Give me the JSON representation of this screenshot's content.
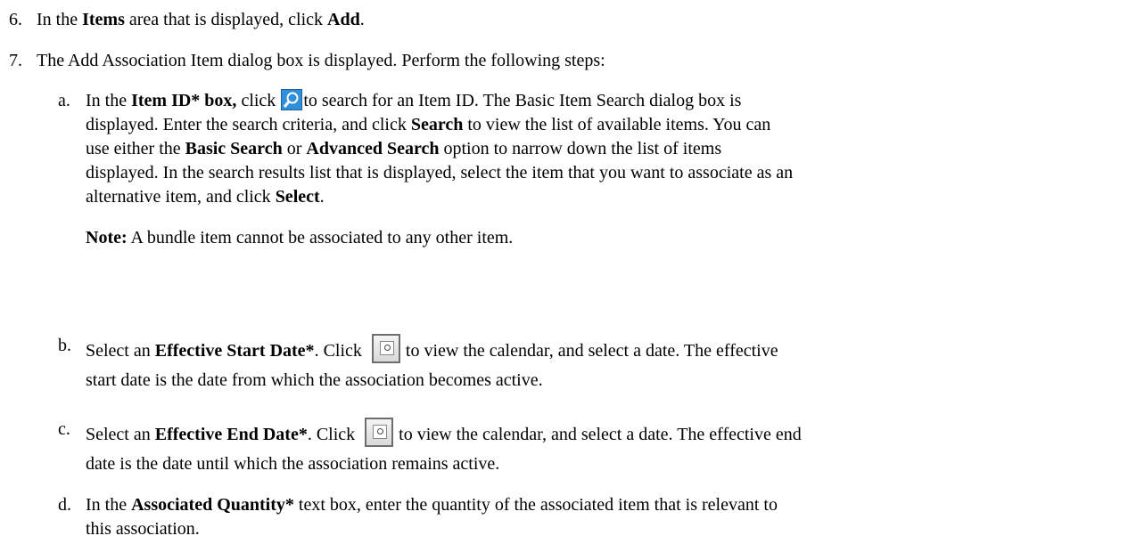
{
  "step6": {
    "num": "6.",
    "t1": "In the ",
    "b1": "Items",
    "t2": " area that is displayed, click ",
    "b2": "Add",
    "t3": "."
  },
  "step7": {
    "num": "7.",
    "text": "The Add Association Item dialog box is displayed. Perform the following steps:"
  },
  "sub_a": {
    "letter": "a.",
    "t1": "In the ",
    "b1": "Item ID* box,",
    "t2": " click ",
    "t3": "to search for an Item ID. The Basic Item Search dialog box is",
    "line2_t1": "displayed. Enter the search criteria, and click ",
    "line2_b1": "Search",
    "line2_t2": " to view the list of available items. You can",
    "line3_t1": "use either the ",
    "line3_b1": "Basic Search",
    "line3_t2": " or ",
    "line3_b2": "Advanced Search",
    "line3_t3": " option to narrow down the list of items",
    "line4": "displayed. In the search results list that is displayed, select the item that you want to associate as an",
    "line5_t1": "alternative item, and click ",
    "line5_b1": "Select",
    "line5_t2": ".",
    "note_b": "Note:",
    "note_t": " A bundle item cannot be associated to any other item."
  },
  "sub_b": {
    "letter": "b.",
    "t1": "Select an ",
    "b1": "Effective Start Date*",
    "t2": ". Click ",
    "t3": "to view the calendar, and select a date. The effective",
    "line2": "start date is the date from which the association becomes active."
  },
  "sub_c": {
    "letter": "c.",
    "t1": "Select an ",
    "b1": "Effective End Date*",
    "t2": ". Click ",
    "t3": "to view the calendar, and select a date. The effective end",
    "line2": "date is the date until which the association remains active."
  },
  "sub_d": {
    "letter": "d.",
    "t1": "In the ",
    "b1": "Associated Quantity*",
    "t2": " text box, enter the quantity of the associated item that is relevant to",
    "line2": "this association."
  },
  "icons": {
    "search": "magnifier-icon",
    "calendar": "calendar-icon"
  }
}
